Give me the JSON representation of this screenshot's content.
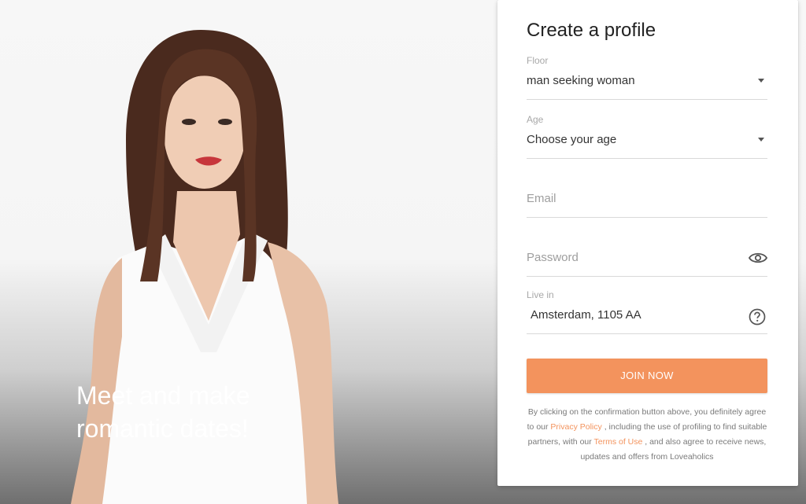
{
  "hero": {
    "tagline_line1": "Meet and make",
    "tagline_line2": "romantic dates!"
  },
  "form": {
    "title": "Create a profile",
    "floor": {
      "label": "Floor",
      "value": "man seeking woman",
      "icon": "chevron-down-icon"
    },
    "age": {
      "label": "Age",
      "value": "Choose your age",
      "icon": "chevron-down-icon"
    },
    "email": {
      "placeholder": "Email"
    },
    "password": {
      "placeholder": "Password",
      "icon": "eye-icon"
    },
    "live_in": {
      "label": "Live in",
      "value": "Amsterdam, 1105 AA",
      "icon": "question-circle-icon"
    },
    "join_label": "JOIN NOW",
    "legal": {
      "part1": "By clicking on the confirmation button above, you definitely agree to our ",
      "privacy_link": "Privacy Policy",
      "part2": " , including the use of profiling to find suitable partners, with our ",
      "terms_link": "Terms of Use",
      "part3": " , and also agree to receive news, updates and offers from Loveaholics"
    }
  },
  "colors": {
    "accent": "#f3935d",
    "panel_bg": "#ffffff",
    "text_dark": "#222222"
  }
}
